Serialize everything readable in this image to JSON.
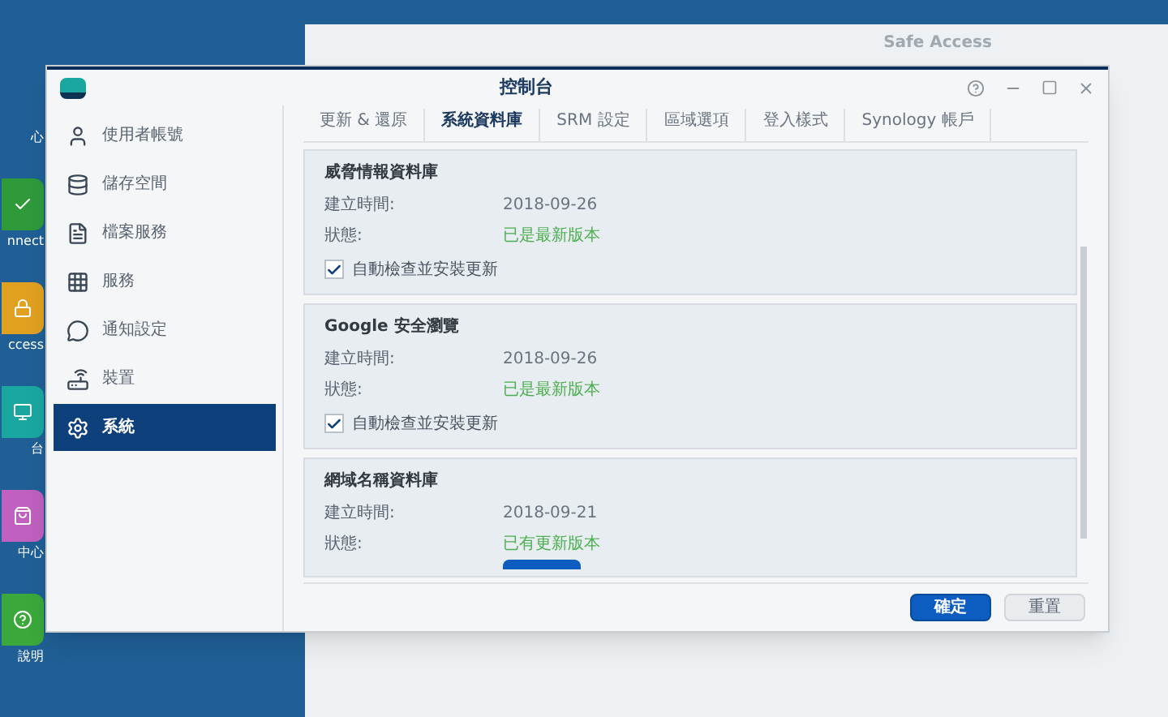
{
  "desktop_icons": [
    {
      "label": "心",
      "kind": "blank"
    },
    {
      "label": "nnect",
      "kind": "green"
    },
    {
      "label": "ccess",
      "kind": "lock"
    },
    {
      "label": "台",
      "kind": "teal"
    },
    {
      "label": "中心",
      "kind": "bag"
    },
    {
      "label": "說明",
      "kind": "help"
    }
  ],
  "background_window": {
    "title": "Safe Access"
  },
  "window": {
    "title": "控制台"
  },
  "sidebar": {
    "items": [
      {
        "label": "使用者帳號",
        "selected": false
      },
      {
        "label": "儲存空間",
        "selected": false
      },
      {
        "label": "檔案服務",
        "selected": false
      },
      {
        "label": "服務",
        "selected": false
      },
      {
        "label": "通知設定",
        "selected": false
      },
      {
        "label": "裝置",
        "selected": false
      },
      {
        "label": "系統",
        "selected": true
      }
    ]
  },
  "tabs": [
    {
      "label": "更新 & 還原",
      "selected": false
    },
    {
      "label": "系統資料庫",
      "selected": true
    },
    {
      "label": "SRM 設定",
      "selected": false
    },
    {
      "label": "區域選項",
      "selected": false
    },
    {
      "label": "登入樣式",
      "selected": false
    },
    {
      "label": "Synology 帳戶",
      "selected": false
    }
  ],
  "sections": [
    {
      "title": "威脅情報資料庫",
      "date_label": "建立時間:",
      "date": "2018-09-26",
      "status_label": "狀態:",
      "status": "已是最新版本",
      "auto_update": {
        "label": "自動檢查並安裝更新",
        "checked": true
      }
    },
    {
      "title": "Google 安全瀏覽",
      "date_label": "建立時間:",
      "date": "2018-09-26",
      "status_label": "狀態:",
      "status": "已是最新版本",
      "auto_update": {
        "label": "自動檢查並安裝更新",
        "checked": true
      }
    },
    {
      "title": "網域名稱資料庫",
      "date_label": "建立時間:",
      "date": "2018-09-21",
      "status_label": "狀態:",
      "status": "已有更新版本",
      "update_button": true
    }
  ],
  "buttons": [
    {
      "label": "確定",
      "kind": "primary"
    },
    {
      "label": "重置",
      "kind": "secondary"
    }
  ]
}
